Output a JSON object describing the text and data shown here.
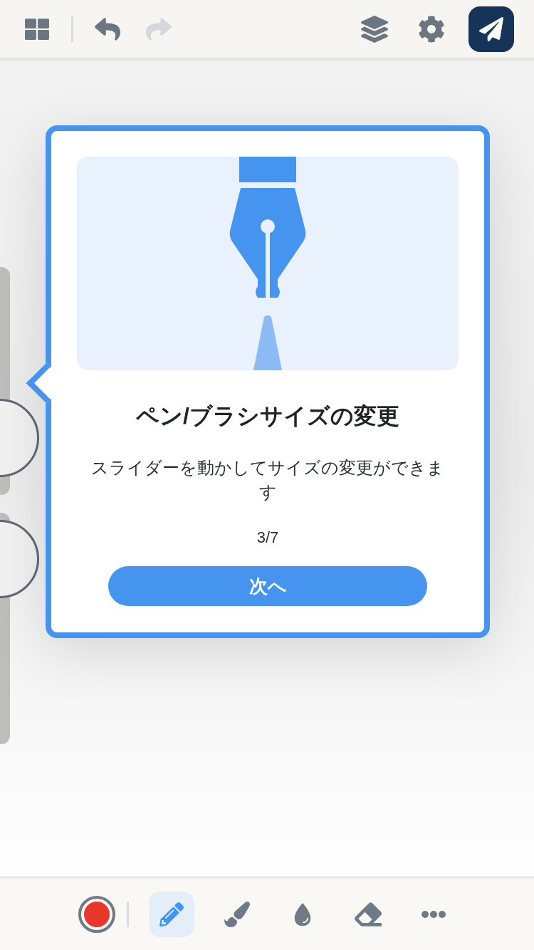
{
  "top_bar": {
    "left": [
      {
        "kind": "gallery",
        "disabled": false
      },
      {
        "kind": "undo",
        "disabled": false
      },
      {
        "kind": "redo",
        "disabled": true
      }
    ],
    "right": [
      {
        "kind": "layers"
      },
      {
        "kind": "settings"
      },
      {
        "kind": "share"
      }
    ]
  },
  "side_sliders": [
    {
      "level": 0.25
    },
    {
      "level": 0.8
    }
  ],
  "tooltip": {
    "title": "ペン/ブラシサイズの変更",
    "description": "スライダーを動かしてサイズの変更ができます",
    "counter": "3/7",
    "button": "次へ"
  },
  "toolbar": [
    {
      "kind": "color",
      "color": "#e8372a",
      "selected": false
    },
    {
      "kind": "pen",
      "selected": true
    },
    {
      "kind": "brush",
      "selected": false
    },
    {
      "kind": "blur",
      "selected": false
    },
    {
      "kind": "eraser",
      "selected": false
    },
    {
      "kind": "more",
      "selected": false
    }
  ]
}
